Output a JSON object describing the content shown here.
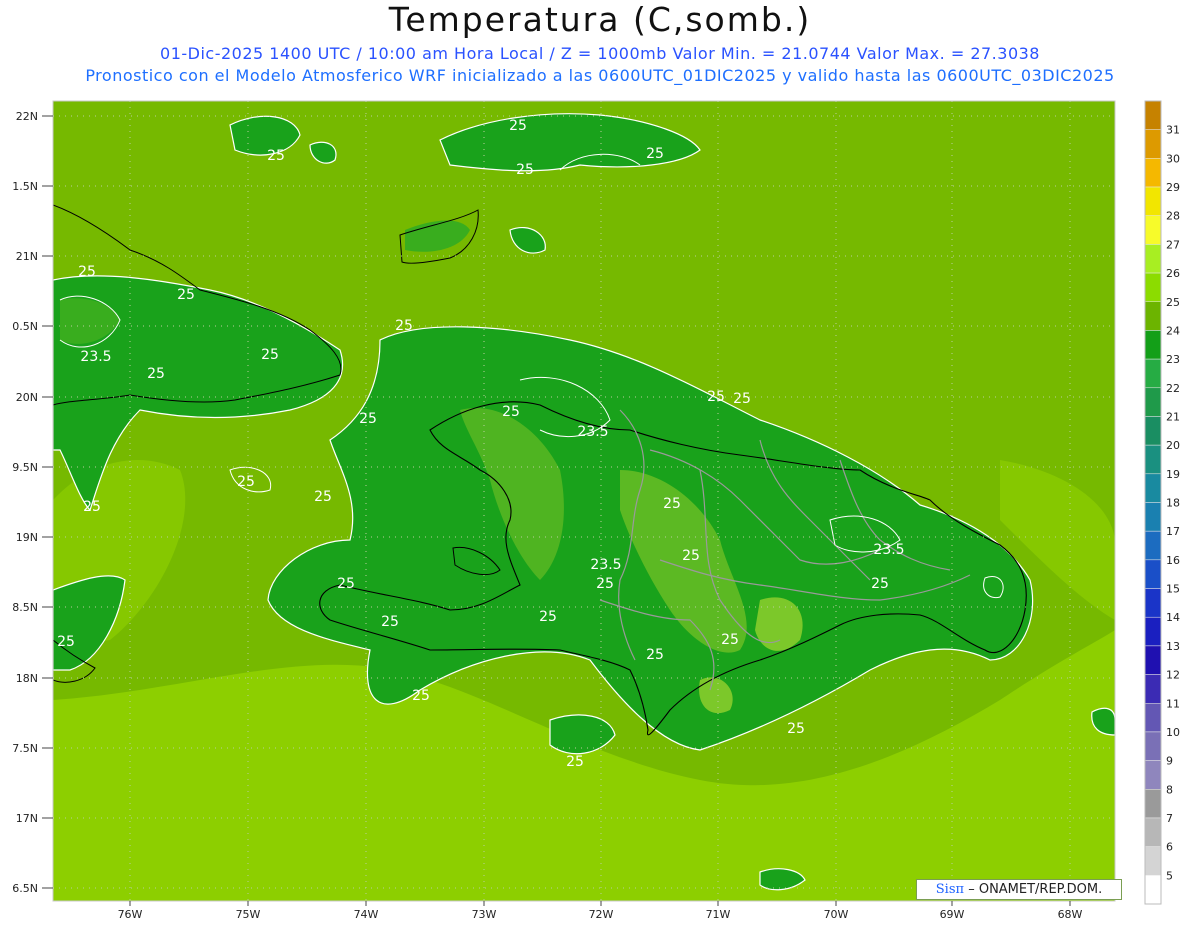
{
  "title": "Temperatura (C,somb.)",
  "subtitle_1": "01-Dic-2025 1400 UTC / 10:00 am Hora Local / Z = 1000mb  Valor Min. = 21.0744  Valor Max. = 27.3038",
  "subtitle_2": "Pronostico con el Modelo Atmosferico WRF inicializado a las 0600UTC_01DIC2025 y valido hasta las  0600UTC_03DIC2025",
  "credit": {
    "sis": "Sis",
    "pi": "π",
    "rest": "– ONAMET/REP.DOM."
  },
  "axes": {
    "lat_labels": [
      "22N",
      "1.5N",
      "21N",
      "0.5N",
      "20N",
      "9.5N",
      "19N",
      "8.5N",
      "18N",
      "7.5N",
      "17N",
      "6.5N"
    ],
    "lon_labels": [
      "76W",
      "75W",
      "74W",
      "73W",
      "72W",
      "71W",
      "70W",
      "69W",
      "68W"
    ]
  },
  "colorbar": {
    "labels": [
      "31",
      "30",
      "29",
      "28",
      "27",
      "26",
      "25",
      "24",
      "23",
      "22",
      "21",
      "20",
      "19",
      "18",
      "17",
      "16",
      "15",
      "14",
      "13",
      "12",
      "11",
      "10",
      "9",
      "8",
      "7",
      "6",
      "5"
    ],
    "colors": [
      "#c68200",
      "#dd9a00",
      "#f5b800",
      "#f2e600",
      "#f7fb2a",
      "#a8ee22",
      "#8cdc00",
      "#6cb400",
      "#139f18",
      "#26ac44",
      "#1f9a4a",
      "#1a8e62",
      "#1a9080",
      "#198aa0",
      "#1a80b0",
      "#1c6cc0",
      "#1a4fc8",
      "#1a34c8",
      "#1a1fc0",
      "#1f10b0",
      "#3b2bb4",
      "#6357b4",
      "#7a70b6",
      "#8f86bd",
      "#9a9a9a",
      "#b7b7b7",
      "#d4d4d4",
      "#ffffff"
    ]
  },
  "contour_labels": {
    "c25": "25",
    "c235": "23.5"
  },
  "palette": {
    "ocean_outer": "#8fd000",
    "ocean_mid": "#76b900",
    "land_dark": "#14a11a",
    "land_medium": "#39ad1e",
    "land_light": "#7bc728",
    "contour": "#ffffff",
    "coast": "#000000",
    "province": "#9a9a9a"
  }
}
